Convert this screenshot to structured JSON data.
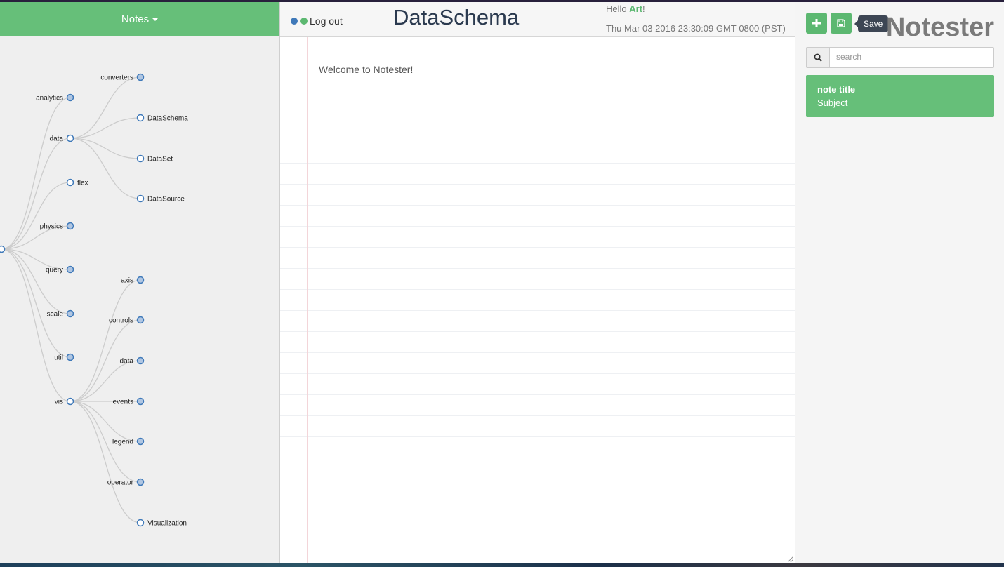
{
  "app": {
    "brand": "Notester",
    "accent_color": "#66bf79",
    "tooltip_bg": "#3d4654"
  },
  "tree_panel": {
    "dropdown_label": "Notes",
    "root_label": "",
    "nodes": [
      "analytics",
      "data",
      "flex",
      "physics",
      "query",
      "scale",
      "util",
      "vis"
    ],
    "data_children": [
      "converters",
      "DataSchema",
      "DataSet",
      "DataSource"
    ],
    "vis_children": [
      "axis",
      "controls",
      "data",
      "events",
      "legend",
      "operator",
      "Visualization"
    ]
  },
  "editor": {
    "logout_label": "Log out",
    "status_dots": [
      "#3f79b9",
      "#5cb871"
    ],
    "title": "DataSchema",
    "greeting_prefix": "Hello ",
    "user_name": "Art",
    "greeting_suffix": "!",
    "datetime": "Thu Mar 03 2016 23:30:09 GMT-0800 (PST)",
    "content": "Welcome to Notester!"
  },
  "sidebar": {
    "add_icon": "plus-icon",
    "save_icon": "save-icon",
    "save_tooltip": "Save",
    "search_icon": "search-icon",
    "search_placeholder": "search",
    "search_value": "",
    "notes": [
      {
        "title": "note title",
        "subject": "Subject"
      }
    ]
  }
}
